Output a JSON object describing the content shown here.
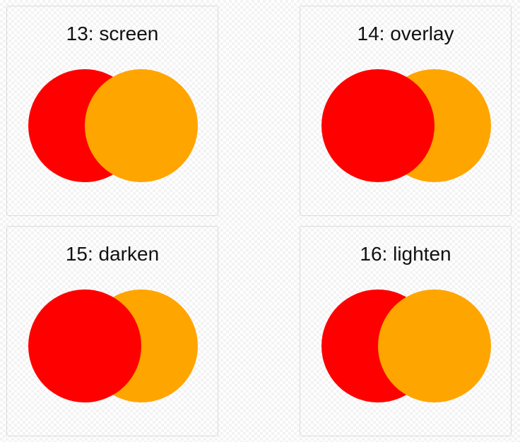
{
  "colors": {
    "first": "#ff0000",
    "second": "#ffa500"
  },
  "cards": [
    {
      "title": "13: screen",
      "blend": "screen",
      "front": "second"
    },
    {
      "title": "14: overlay",
      "blend": "overlay",
      "front": "first"
    },
    {
      "title": "15: darken",
      "blend": "darken",
      "front": "first"
    },
    {
      "title": "16: lighten",
      "blend": "lighten",
      "front": "second"
    }
  ]
}
